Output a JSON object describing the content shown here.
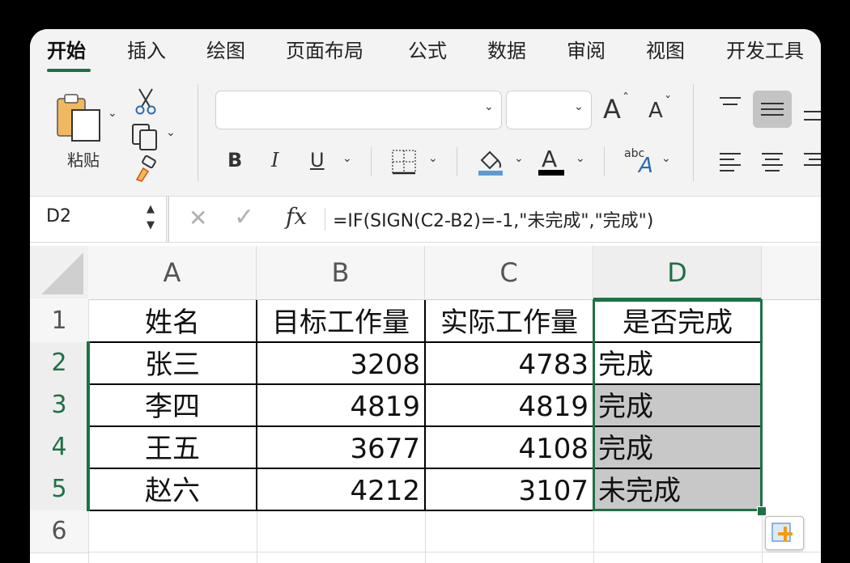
{
  "tabs": [
    "开始",
    "插入",
    "绘图",
    "页面布局",
    "公式",
    "数据",
    "审阅",
    "视图",
    "开发工具"
  ],
  "ribbon": {
    "paste_label": "粘贴",
    "bold": "B",
    "italic": "I",
    "underline": "U",
    "font_grow": "A",
    "font_shrink": "A",
    "font_color_glyph": "A",
    "abc": "abc"
  },
  "formula_bar": {
    "name_box": "D2",
    "cancel": "✕",
    "confirm": "✓",
    "fx": "fx",
    "formula": "=IF(SIGN(C2-B2)=-1,\"未完成\",\"完成\")"
  },
  "columns": [
    "A",
    "B",
    "C",
    "D"
  ],
  "rows": [
    "1",
    "2",
    "3",
    "4",
    "5",
    "6"
  ],
  "table": {
    "header": [
      "姓名",
      "目标工作量",
      "实际工作量",
      "是否完成"
    ],
    "data": [
      [
        "张三",
        "3208",
        "4783",
        "完成"
      ],
      [
        "李四",
        "4819",
        "4819",
        "完成"
      ],
      [
        "王五",
        "3677",
        "4108",
        "完成"
      ],
      [
        "赵六",
        "4212",
        "3107",
        "未完成"
      ]
    ]
  },
  "colors": {
    "accent": "#1e7145",
    "selection_fill": "#c8c8c8",
    "ribbon_bg": "#f3f3f3"
  }
}
